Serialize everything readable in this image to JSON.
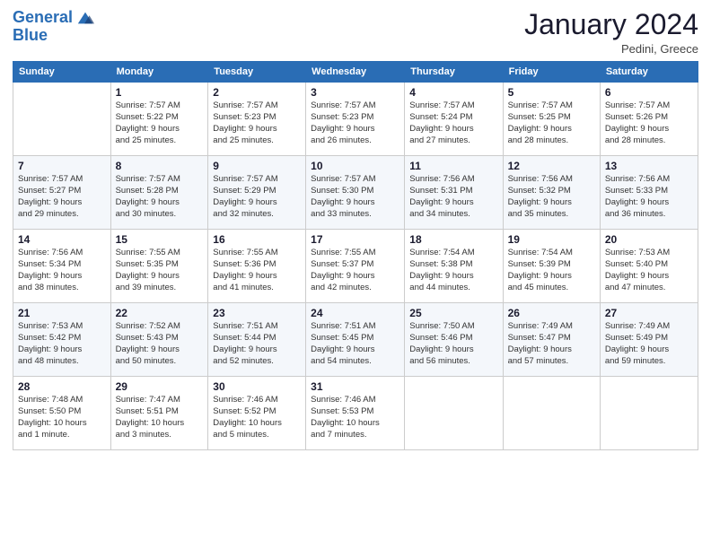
{
  "header": {
    "logo_line1": "General",
    "logo_line2": "Blue",
    "month": "January 2024",
    "location": "Pedini, Greece"
  },
  "days_of_week": [
    "Sunday",
    "Monday",
    "Tuesday",
    "Wednesday",
    "Thursday",
    "Friday",
    "Saturday"
  ],
  "weeks": [
    [
      {
        "day": "",
        "info": ""
      },
      {
        "day": "1",
        "info": "Sunrise: 7:57 AM\nSunset: 5:22 PM\nDaylight: 9 hours\nand 25 minutes."
      },
      {
        "day": "2",
        "info": "Sunrise: 7:57 AM\nSunset: 5:23 PM\nDaylight: 9 hours\nand 25 minutes."
      },
      {
        "day": "3",
        "info": "Sunrise: 7:57 AM\nSunset: 5:23 PM\nDaylight: 9 hours\nand 26 minutes."
      },
      {
        "day": "4",
        "info": "Sunrise: 7:57 AM\nSunset: 5:24 PM\nDaylight: 9 hours\nand 27 minutes."
      },
      {
        "day": "5",
        "info": "Sunrise: 7:57 AM\nSunset: 5:25 PM\nDaylight: 9 hours\nand 28 minutes."
      },
      {
        "day": "6",
        "info": "Sunrise: 7:57 AM\nSunset: 5:26 PM\nDaylight: 9 hours\nand 28 minutes."
      }
    ],
    [
      {
        "day": "7",
        "info": "Sunrise: 7:57 AM\nSunset: 5:27 PM\nDaylight: 9 hours\nand 29 minutes."
      },
      {
        "day": "8",
        "info": "Sunrise: 7:57 AM\nSunset: 5:28 PM\nDaylight: 9 hours\nand 30 minutes."
      },
      {
        "day": "9",
        "info": "Sunrise: 7:57 AM\nSunset: 5:29 PM\nDaylight: 9 hours\nand 32 minutes."
      },
      {
        "day": "10",
        "info": "Sunrise: 7:57 AM\nSunset: 5:30 PM\nDaylight: 9 hours\nand 33 minutes."
      },
      {
        "day": "11",
        "info": "Sunrise: 7:56 AM\nSunset: 5:31 PM\nDaylight: 9 hours\nand 34 minutes."
      },
      {
        "day": "12",
        "info": "Sunrise: 7:56 AM\nSunset: 5:32 PM\nDaylight: 9 hours\nand 35 minutes."
      },
      {
        "day": "13",
        "info": "Sunrise: 7:56 AM\nSunset: 5:33 PM\nDaylight: 9 hours\nand 36 minutes."
      }
    ],
    [
      {
        "day": "14",
        "info": "Sunrise: 7:56 AM\nSunset: 5:34 PM\nDaylight: 9 hours\nand 38 minutes."
      },
      {
        "day": "15",
        "info": "Sunrise: 7:55 AM\nSunset: 5:35 PM\nDaylight: 9 hours\nand 39 minutes."
      },
      {
        "day": "16",
        "info": "Sunrise: 7:55 AM\nSunset: 5:36 PM\nDaylight: 9 hours\nand 41 minutes."
      },
      {
        "day": "17",
        "info": "Sunrise: 7:55 AM\nSunset: 5:37 PM\nDaylight: 9 hours\nand 42 minutes."
      },
      {
        "day": "18",
        "info": "Sunrise: 7:54 AM\nSunset: 5:38 PM\nDaylight: 9 hours\nand 44 minutes."
      },
      {
        "day": "19",
        "info": "Sunrise: 7:54 AM\nSunset: 5:39 PM\nDaylight: 9 hours\nand 45 minutes."
      },
      {
        "day": "20",
        "info": "Sunrise: 7:53 AM\nSunset: 5:40 PM\nDaylight: 9 hours\nand 47 minutes."
      }
    ],
    [
      {
        "day": "21",
        "info": "Sunrise: 7:53 AM\nSunset: 5:42 PM\nDaylight: 9 hours\nand 48 minutes."
      },
      {
        "day": "22",
        "info": "Sunrise: 7:52 AM\nSunset: 5:43 PM\nDaylight: 9 hours\nand 50 minutes."
      },
      {
        "day": "23",
        "info": "Sunrise: 7:51 AM\nSunset: 5:44 PM\nDaylight: 9 hours\nand 52 minutes."
      },
      {
        "day": "24",
        "info": "Sunrise: 7:51 AM\nSunset: 5:45 PM\nDaylight: 9 hours\nand 54 minutes."
      },
      {
        "day": "25",
        "info": "Sunrise: 7:50 AM\nSunset: 5:46 PM\nDaylight: 9 hours\nand 56 minutes."
      },
      {
        "day": "26",
        "info": "Sunrise: 7:49 AM\nSunset: 5:47 PM\nDaylight: 9 hours\nand 57 minutes."
      },
      {
        "day": "27",
        "info": "Sunrise: 7:49 AM\nSunset: 5:49 PM\nDaylight: 9 hours\nand 59 minutes."
      }
    ],
    [
      {
        "day": "28",
        "info": "Sunrise: 7:48 AM\nSunset: 5:50 PM\nDaylight: 10 hours\nand 1 minute."
      },
      {
        "day": "29",
        "info": "Sunrise: 7:47 AM\nSunset: 5:51 PM\nDaylight: 10 hours\nand 3 minutes."
      },
      {
        "day": "30",
        "info": "Sunrise: 7:46 AM\nSunset: 5:52 PM\nDaylight: 10 hours\nand 5 minutes."
      },
      {
        "day": "31",
        "info": "Sunrise: 7:46 AM\nSunset: 5:53 PM\nDaylight: 10 hours\nand 7 minutes."
      },
      {
        "day": "",
        "info": ""
      },
      {
        "day": "",
        "info": ""
      },
      {
        "day": "",
        "info": ""
      }
    ]
  ]
}
